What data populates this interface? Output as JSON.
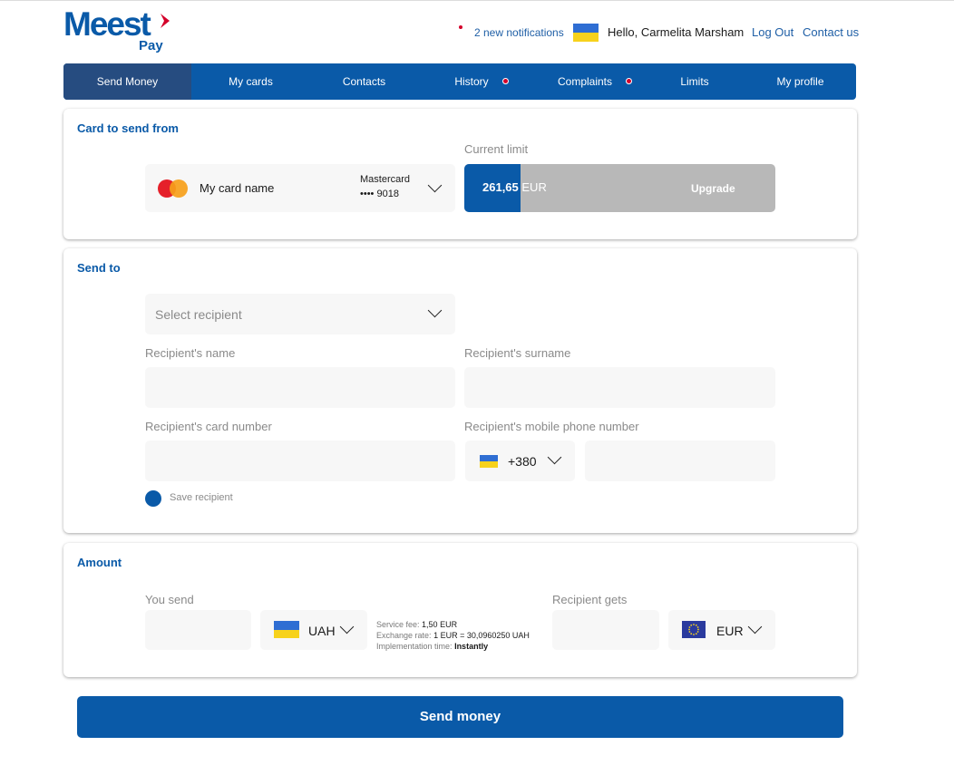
{
  "brand": {
    "logo_main": "Meest",
    "logo_sub": "Pay"
  },
  "header": {
    "notifications": "2 new notifications",
    "greeting": "Hello, Carmelita Marsham",
    "logout": "Log Out",
    "contact": "Contact us"
  },
  "nav": {
    "items": [
      "Send Money",
      "My cards",
      "Contacts",
      "History",
      "Complaints",
      "Limits",
      "My profile"
    ],
    "active": "Send Money"
  },
  "card_from": {
    "title": "Card to send from",
    "card_name": "My card name",
    "card_brand": "Mastercard",
    "card_number": "•••• 9018",
    "limit_label": "Current limit",
    "limit_value": "261,65",
    "limit_currency": "EUR",
    "limit_fill_fraction": 0.18,
    "upgrade": "Upgrade"
  },
  "send_to": {
    "title": "Send to",
    "select_placeholder": "Select recipient",
    "name_label": "Recipient's name",
    "surname_label": "Recipient's surname",
    "card_label": "Recipient's card number",
    "phone_label": "Recipient's mobile phone number",
    "phone_code": "+380",
    "save_label": "Save recipient"
  },
  "amount": {
    "title": "Amount",
    "you_send_label": "You send",
    "send_currency": "UAH",
    "recipient_gets_label": "Recipient gets",
    "receive_currency": "EUR",
    "fee_label": "Service fee:",
    "fee_value": "1,50 EUR",
    "rate_label": "Exchange rate:",
    "rate_value": "1 EUR = 30,0960250 UAH",
    "time_label": "Implementation time:",
    "time_value": "Instantly"
  },
  "actions": {
    "send": "Send money"
  },
  "colors": {
    "primary": "#0a5aa8",
    "nav_active": "#264c80",
    "field_bg": "#f7f7f7",
    "limit_rest": "#b8b8b8",
    "alert": "#d4002a"
  }
}
